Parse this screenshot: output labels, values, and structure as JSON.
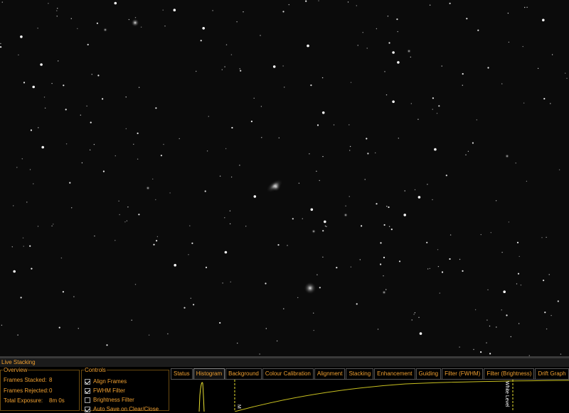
{
  "panel": {
    "title": "Live Stacking"
  },
  "overview": {
    "legend": "Overview",
    "frames_stacked_label": "Frames Stacked:",
    "frames_stacked_value": "8",
    "frames_rejected_label": "Frames Rejected:",
    "frames_rejected_value": "0",
    "total_exposure_label": "Total Exposure:",
    "total_exposure_value": "8m 0s"
  },
  "controls": {
    "legend": "Controls",
    "items": [
      {
        "label": "Align Frames",
        "checked": true
      },
      {
        "label": "FWHM Filter",
        "checked": true
      },
      {
        "label": "Brightness Filter",
        "checked": false
      },
      {
        "label": "Auto Save on Clear/Close",
        "checked": true
      }
    ]
  },
  "tabs": [
    "Status",
    "Histogram",
    "Background",
    "Colour Calibration",
    "Alignment",
    "Stacking",
    "Enhancement",
    "Guiding",
    "Filter (FWHM)",
    "Filter (Brightness)",
    "Drift Graph"
  ],
  "active_tab": "Histogram",
  "histogram": {
    "white_level_label": "White Level",
    "mid_level_label": "M"
  },
  "colors": {
    "accent": "#f0a030",
    "histogram_line": "#e8e030",
    "background": "#000000"
  }
}
